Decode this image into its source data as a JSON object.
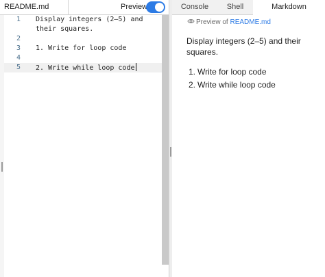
{
  "editor": {
    "file_tab": "README.md",
    "preview_label": "Preview",
    "preview_enabled": true,
    "lines": [
      {
        "num": "1",
        "text": "Display integers (2–5) and"
      },
      {
        "num": "",
        "text": "their squares."
      },
      {
        "num": "2",
        "text": ""
      },
      {
        "num": "3",
        "text": "1. Write for loop code"
      },
      {
        "num": "4",
        "text": ""
      },
      {
        "num": "5",
        "text": "2. Write while loop code"
      }
    ],
    "active_line": "5"
  },
  "right_panel": {
    "tabs": [
      "Console",
      "Shell",
      "Markdown"
    ],
    "active_tab": "Markdown",
    "preview_prefix": "Preview of ",
    "preview_file": "README.md",
    "paragraph": "Display integers (2–5) and their squares.",
    "list": [
      {
        "num": "1.",
        "text": "Write for loop code"
      },
      {
        "num": "2.",
        "text": "Write while loop code"
      }
    ]
  },
  "colors": {
    "accent": "#2d7be5",
    "line_number": "#4a6f8c",
    "scrollbar": "#c9c9c9"
  },
  "icons": {
    "eye": "eye-icon"
  }
}
